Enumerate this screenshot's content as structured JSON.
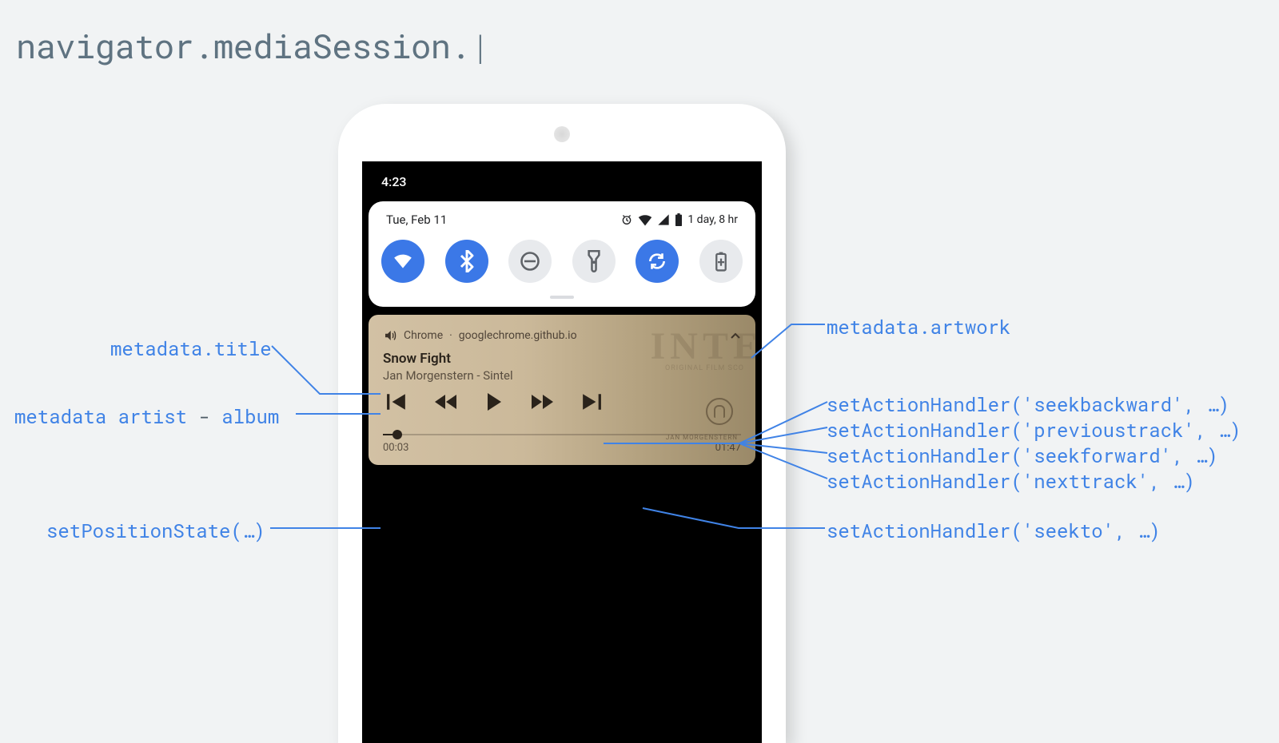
{
  "heading": {
    "api": "navigator.mediaSession.",
    "cursor": "|"
  },
  "phone": {
    "statusbar": {
      "time": "4:23"
    },
    "quicksettings": {
      "date": "Tue, Feb 11",
      "battery_text": "1 day, 8 hr",
      "tiles": [
        {
          "name": "wifi",
          "active": true
        },
        {
          "name": "bluetooth",
          "active": true
        },
        {
          "name": "dnd",
          "active": false
        },
        {
          "name": "flashlight",
          "active": false
        },
        {
          "name": "autorotate",
          "active": true
        },
        {
          "name": "battery-saver",
          "active": false
        }
      ]
    },
    "media": {
      "app": "Chrome",
      "origin_separator": " · ",
      "origin": "googlechrome.github.io",
      "title": "Snow Fight",
      "artist_album": "Jan Morgenstern - Sintel",
      "time_current": "00:03",
      "time_total": "01:47",
      "bg_title": "INTE",
      "bg_sub": "ORIGINAL FILM SCO",
      "bg_credit": "JAN MORGENSTERN"
    }
  },
  "labels": {
    "left": {
      "title": "metadata.title",
      "artist_album_pre": "metadata artist",
      "artist_album_dash": " - ",
      "artist_album_post": "album",
      "position": "setPositionState(…)"
    },
    "right": {
      "artwork": "metadata.artwork",
      "seekbackward": "setActionHandler('seekbackward', …)",
      "previoustrack": "setActionHandler('previoustrack', …)",
      "seekforward": "setActionHandler('seekforward', …)",
      "nexttrack": "setActionHandler('nexttrack', …)",
      "seekto": "setActionHandler('seekto', …)"
    }
  }
}
